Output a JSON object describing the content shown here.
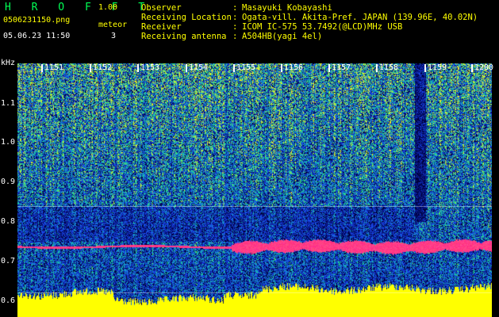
{
  "app": {
    "name": "H R O F F T",
    "version": "1.00"
  },
  "file": {
    "name": "0506231150.png",
    "datetime": "05.06.23 11:50"
  },
  "meteor": {
    "label": "meteor",
    "count": "3"
  },
  "meta": {
    "observer": {
      "key": "Observer",
      "value": "Masayuki Kobayashi"
    },
    "location": {
      "key": "Receiving Location",
      "value": "Ogata-vill. Akita-Pref. JAPAN (139.96E, 40.02N)"
    },
    "receiver": {
      "key": "Receiver",
      "value": "ICOM IC-575 53.7492(@LCD)MHz USB"
    },
    "antenna": {
      "key": "Receiving antenna",
      "value": "A504HB(yagi 4el)"
    }
  },
  "spectrogram": {
    "y_unit": "kHz",
    "y_ticks": [
      "1.1",
      "1.0",
      "0.9",
      "0.8",
      "0.7",
      "0.6"
    ],
    "x_ticks": [
      "1151",
      "1152",
      "1153",
      "1154",
      "1155",
      "1156",
      "1157",
      "1158",
      "1159",
      "1200"
    ],
    "colors": {
      "bg_noise": "#1a3ad0",
      "mid": "#1fd4a0",
      "high": "#ffee00",
      "signal": "#ff2a7a",
      "floor": "#ffff00"
    }
  }
}
